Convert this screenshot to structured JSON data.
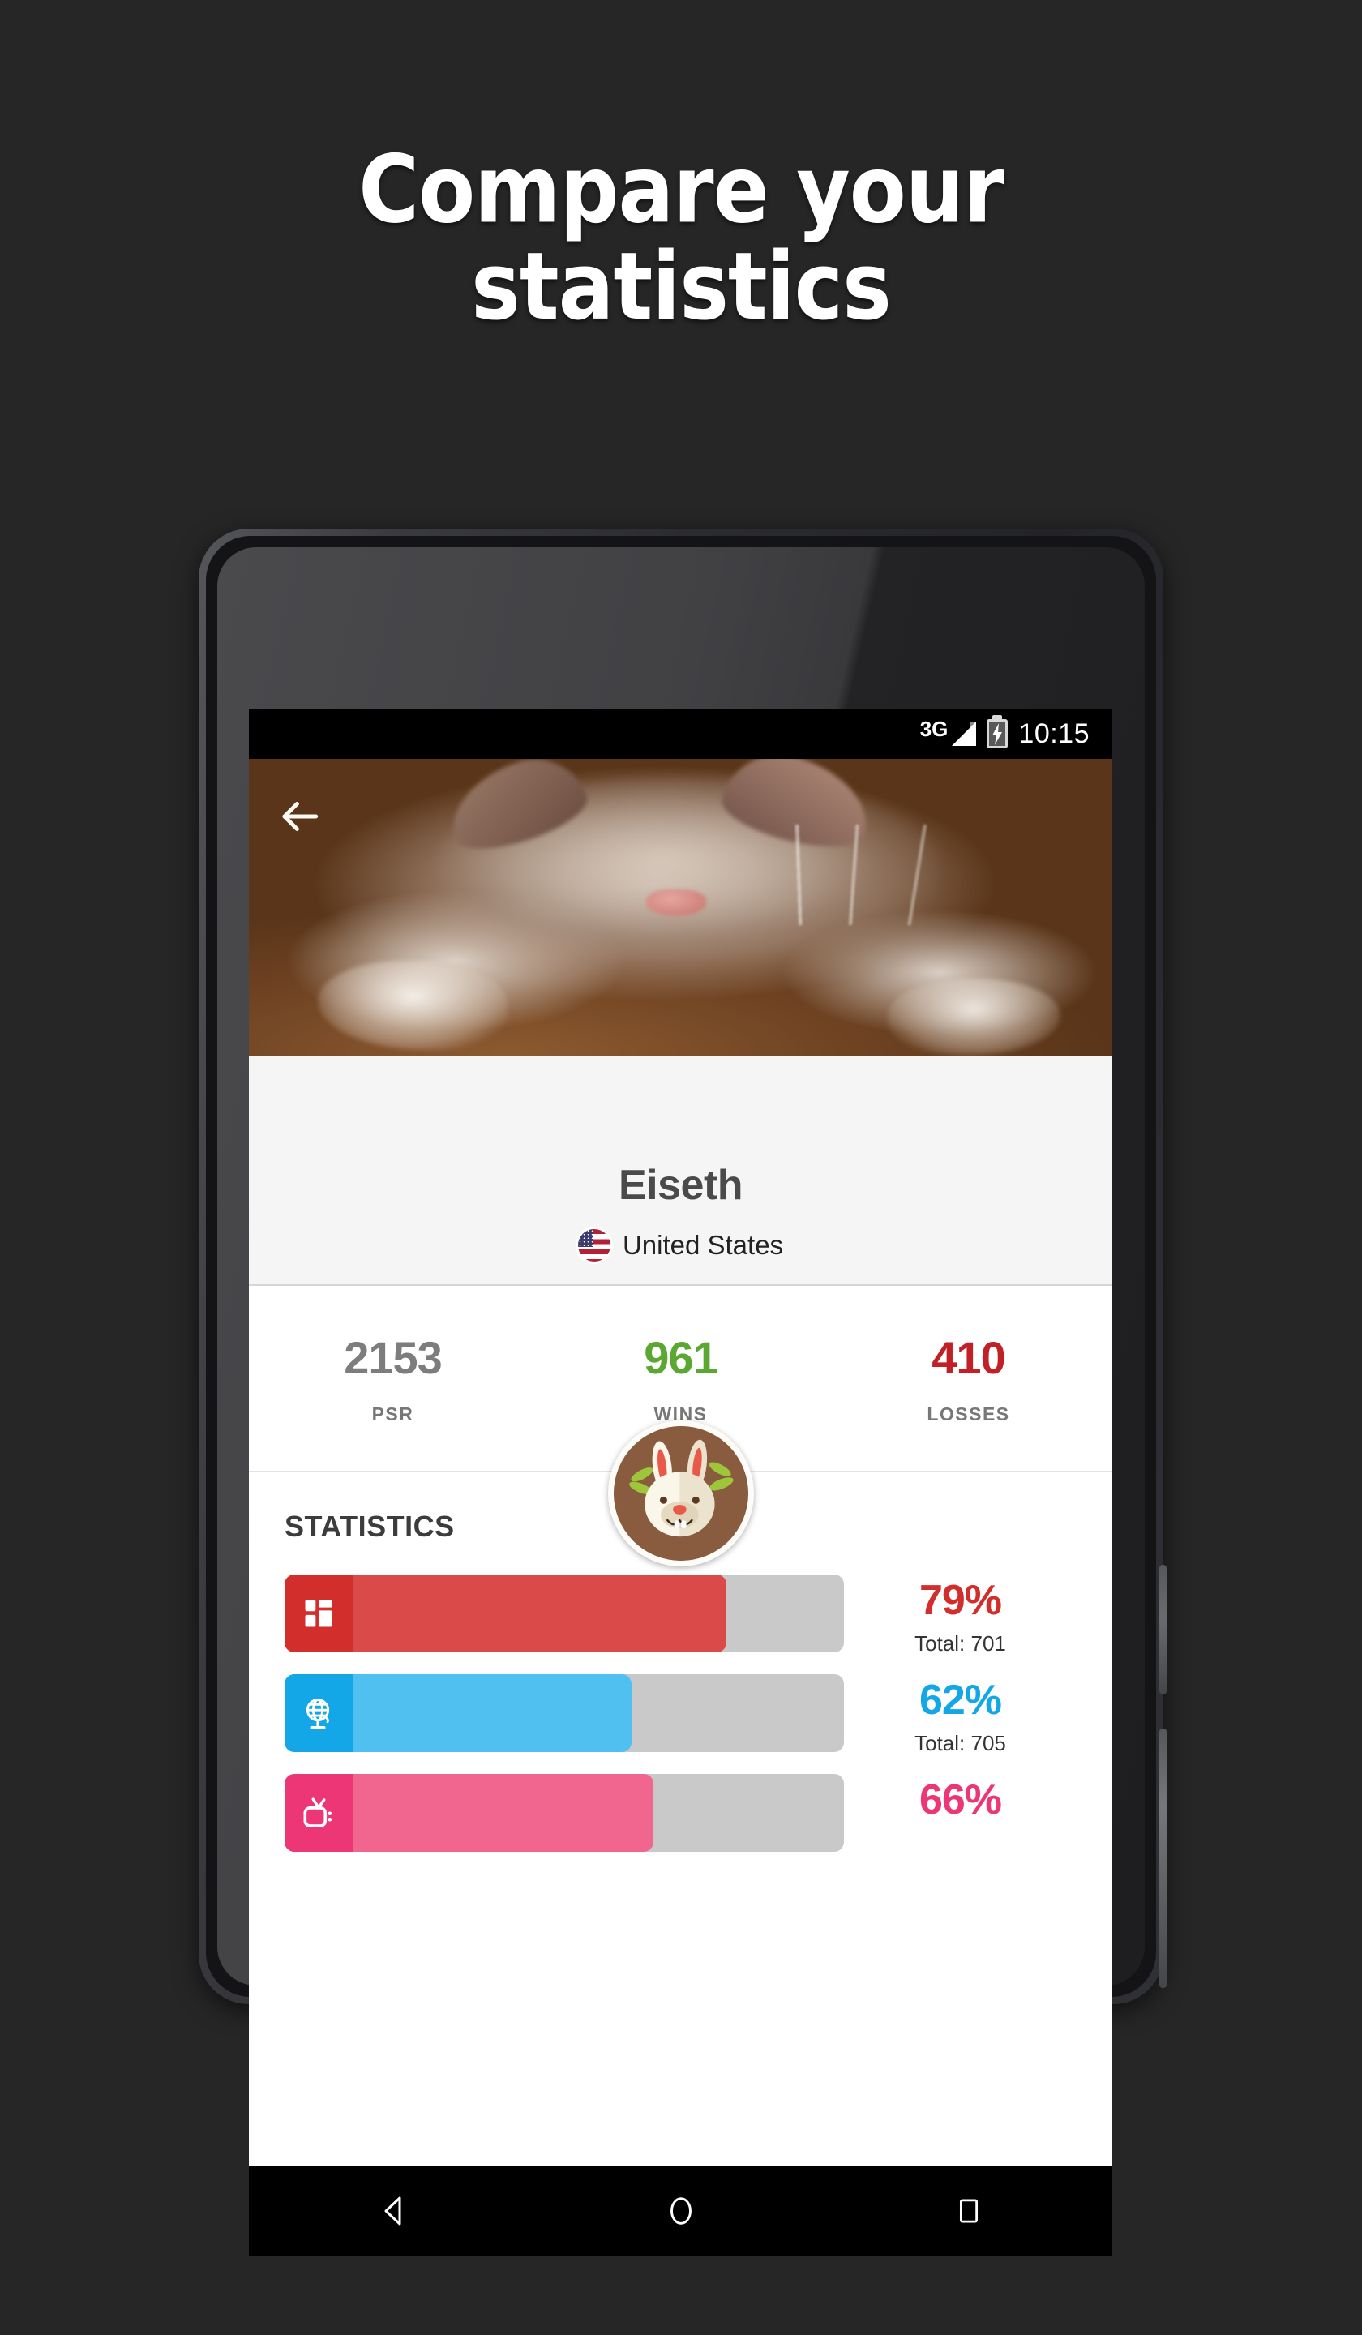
{
  "promo": {
    "headline_line1": "Compare your",
    "headline_line2": "statistics",
    "background_color": "#262626"
  },
  "status_bar": {
    "network": "3G",
    "battery_icon": "battery-charging-icon",
    "signal_icon": "signal-3g-icon",
    "time": "10:15"
  },
  "header": {
    "back_icon": "back-arrow-icon",
    "cover_photo": "sleeping-kitten-photo",
    "avatar_icon": "rabbit-avatar-icon"
  },
  "profile": {
    "username": "Eiseth",
    "country": "United States",
    "flag_icon": "flag-united-states-icon"
  },
  "summary": {
    "items": [
      {
        "value": "2153",
        "label": "PSR",
        "color": "#7d7d7d"
      },
      {
        "value": "961",
        "label": "WINS",
        "color": "#5aa832"
      },
      {
        "value": "410",
        "label": "LOSSES",
        "color": "#c12026"
      }
    ]
  },
  "statistics": {
    "title": "STATISTICS",
    "rows": [
      {
        "icon": "grid-blocks-icon",
        "percent": "79%",
        "percent_value": 79,
        "total": "Total: 701",
        "color": "#d94a48",
        "icon_color": "#d22e2b"
      },
      {
        "icon": "globe-icon",
        "percent": "62%",
        "percent_value": 62,
        "total": "Total: 705",
        "color": "#4fc0f0",
        "icon_color": "#13a7e8"
      },
      {
        "icon": "television-icon",
        "percent": "66%",
        "percent_value": 66,
        "total": "",
        "color": "#f0668f",
        "icon_color": "#ec3676"
      }
    ]
  },
  "navigation_bar": {
    "back": "nav-back-icon",
    "home": "nav-home-icon",
    "recents": "nav-recents-icon"
  },
  "chart_data": {
    "type": "bar",
    "title": "STATISTICS",
    "categories": [
      "grid-blocks",
      "globe",
      "television"
    ],
    "values": [
      79,
      62,
      66
    ],
    "totals": [
      701,
      705,
      null
    ],
    "ylabel": "percent",
    "ylim": [
      0,
      100
    ]
  }
}
